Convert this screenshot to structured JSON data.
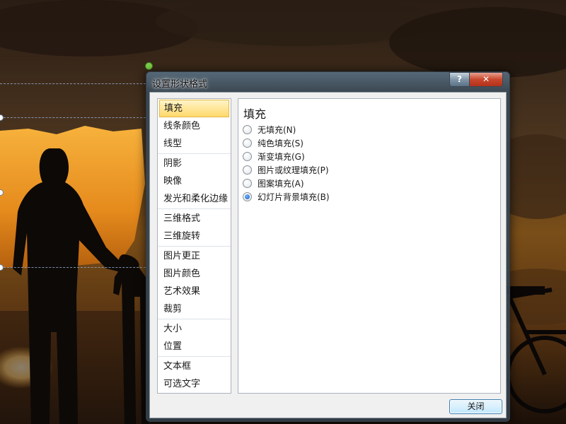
{
  "dialog": {
    "title": "设置形状格式",
    "help_label": "?",
    "close_x_label": "✕",
    "close_button_label": "关闭"
  },
  "categories": [
    [
      "填充",
      "线条颜色",
      "线型"
    ],
    [
      "阴影",
      "映像",
      "发光和柔化边缘"
    ],
    [
      "三维格式",
      "三维旋转"
    ],
    [
      "图片更正",
      "图片颜色",
      "艺术效果",
      "裁剪"
    ],
    [
      "大小",
      "位置"
    ],
    [
      "文本框",
      "可选文字"
    ]
  ],
  "selected_category": "填充",
  "panel": {
    "title": "填充",
    "options": [
      {
        "label": "无填充(N)",
        "checked": false
      },
      {
        "label": "纯色填充(S)",
        "checked": false
      },
      {
        "label": "渐变填充(G)",
        "checked": false
      },
      {
        "label": "图片或纹理填充(P)",
        "checked": false
      },
      {
        "label": "图案填充(A)",
        "checked": false
      },
      {
        "label": "幻灯片背景填充(B)",
        "checked": true
      }
    ]
  }
}
